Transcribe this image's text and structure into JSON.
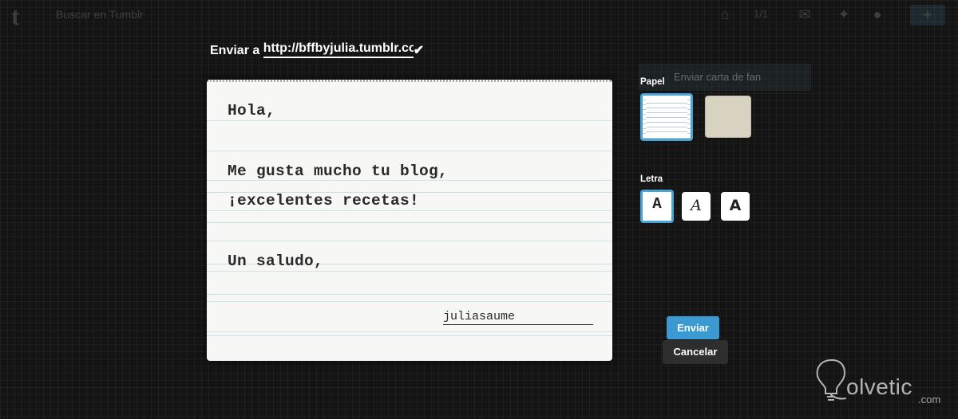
{
  "topbar": {
    "logo": "t",
    "dash_text": "Buscar en Tumblr",
    "count": "1/1",
    "post_label": "✚"
  },
  "ghost_button": "Enviar carta de fan",
  "send_to": {
    "label": "Enviar a",
    "url": "http://bffbyjulia.tumblr.com",
    "check": "✔"
  },
  "letter": {
    "lines": [
      "Hola,",
      "Me gusta mucho tu blog,",
      "¡excelentes recetas!",
      "Un saludo,"
    ],
    "signature": "juliasaume"
  },
  "options": {
    "paper_label": "Papel",
    "paper_options": [
      "lined",
      "cream"
    ],
    "font_label": "Letra",
    "font_options": [
      "A",
      "A",
      "A"
    ],
    "selected_paper": "lined",
    "selected_font": 0
  },
  "actions": {
    "send": "Enviar",
    "cancel": "Cancelar"
  },
  "watermark": {
    "text": "olvetic",
    "tld": ".com"
  },
  "colors": {
    "accent": "#3a9ad1",
    "background": "#141414"
  }
}
